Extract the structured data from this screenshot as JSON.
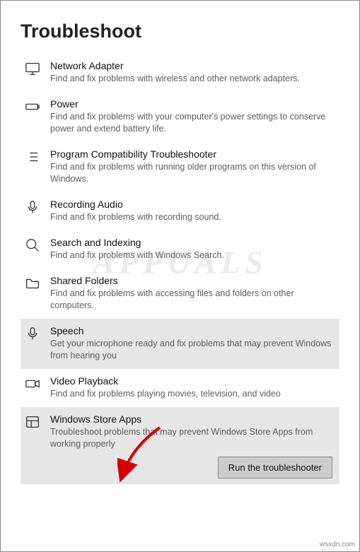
{
  "page": {
    "title": "Troubleshoot"
  },
  "items": [
    {
      "title": "Network Adapter",
      "desc": "Find and fix problems with wireless and other network adapters."
    },
    {
      "title": "Power",
      "desc": "Find and fix problems with your computer's power settings to conserve power and extend battery life."
    },
    {
      "title": "Program Compatibility Troubleshooter",
      "desc": "Find and fix problems with running older programs on this version of Windows."
    },
    {
      "title": "Recording Audio",
      "desc": "Find and fix problems with recording sound."
    },
    {
      "title": "Search and Indexing",
      "desc": "Find and fix problems with Windows Search."
    },
    {
      "title": "Shared Folders",
      "desc": "Find and fix problems with accessing files and folders on other computers."
    },
    {
      "title": "Speech",
      "desc": "Get your microphone ready and fix problems that may prevent Windows from hearing you"
    },
    {
      "title": "Video Playback",
      "desc": "Find and fix problems playing movies, television, and video"
    },
    {
      "title": "Windows Store Apps",
      "desc": "Troubleshoot problems that may prevent Windows Store Apps from working properly"
    }
  ],
  "actions": {
    "run": "Run the troubleshooter"
  },
  "watermark": "APPUALS",
  "footer": "wsxdn.com"
}
